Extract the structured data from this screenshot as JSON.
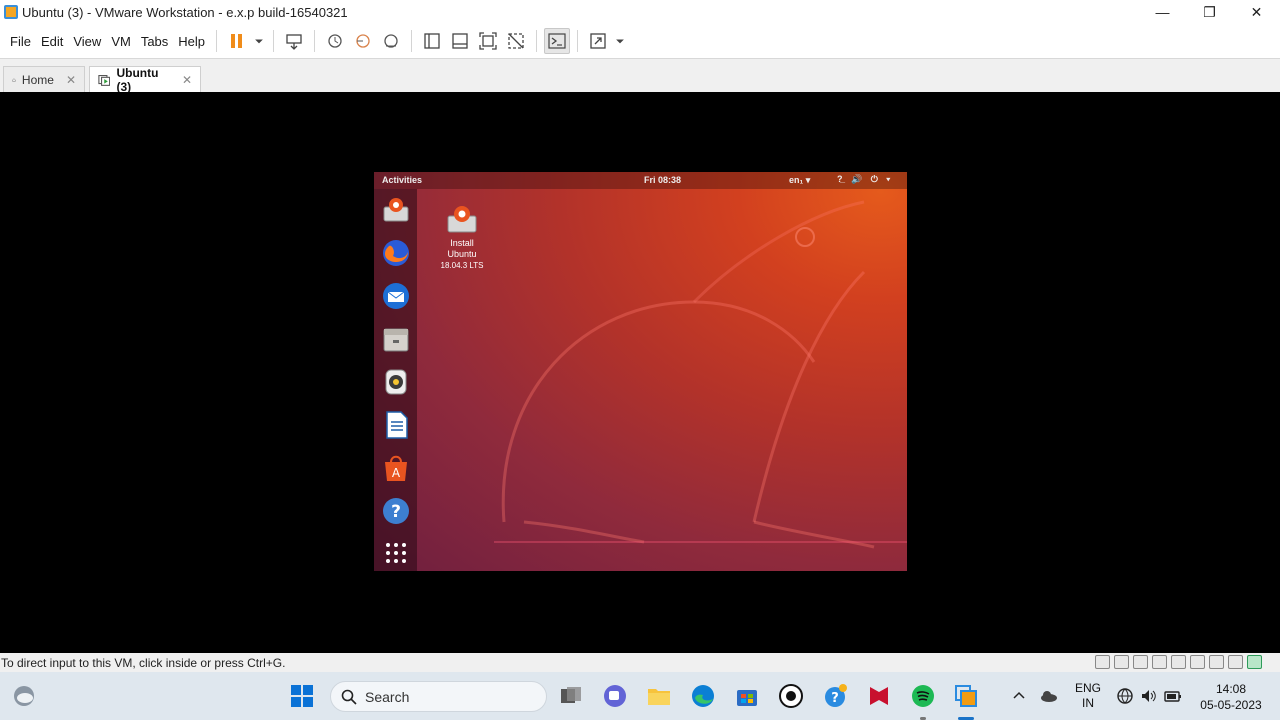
{
  "window": {
    "title": "Ubuntu (3) - VMware Workstation - e.x.p build-16540321",
    "minimize": "—",
    "maximize": "❐",
    "close": "✕"
  },
  "menu": {
    "items": [
      "File",
      "Edit",
      "View",
      "VM",
      "Tabs",
      "Help"
    ]
  },
  "tabs": [
    {
      "label": "Home",
      "active": false
    },
    {
      "label": "Ubuntu (3)",
      "active": true
    }
  ],
  "guest": {
    "activities": "Activities",
    "clock": "Fri 08:38",
    "language": "en₁ ▾",
    "tray": "?̲ 🔊 ⏻ ▾",
    "desktop_icon": {
      "line1": "Install",
      "line2": "Ubuntu",
      "line3": "18.04.3 LTS"
    },
    "dock": [
      "install-ubuntu-icon",
      "firefox-icon",
      "thunderbird-icon",
      "files-icon",
      "rhythmbox-icon",
      "libreoffice-writer-icon",
      "ubuntu-software-icon",
      "help-icon",
      "show-applications-icon"
    ]
  },
  "status": {
    "message": "To direct input to this VM, click inside or press Ctrl+G."
  },
  "taskbar": {
    "search_label": "Search",
    "lang_line1": "ENG",
    "lang_line2": "IN",
    "time": "14:08",
    "date": "05-05-2023"
  }
}
